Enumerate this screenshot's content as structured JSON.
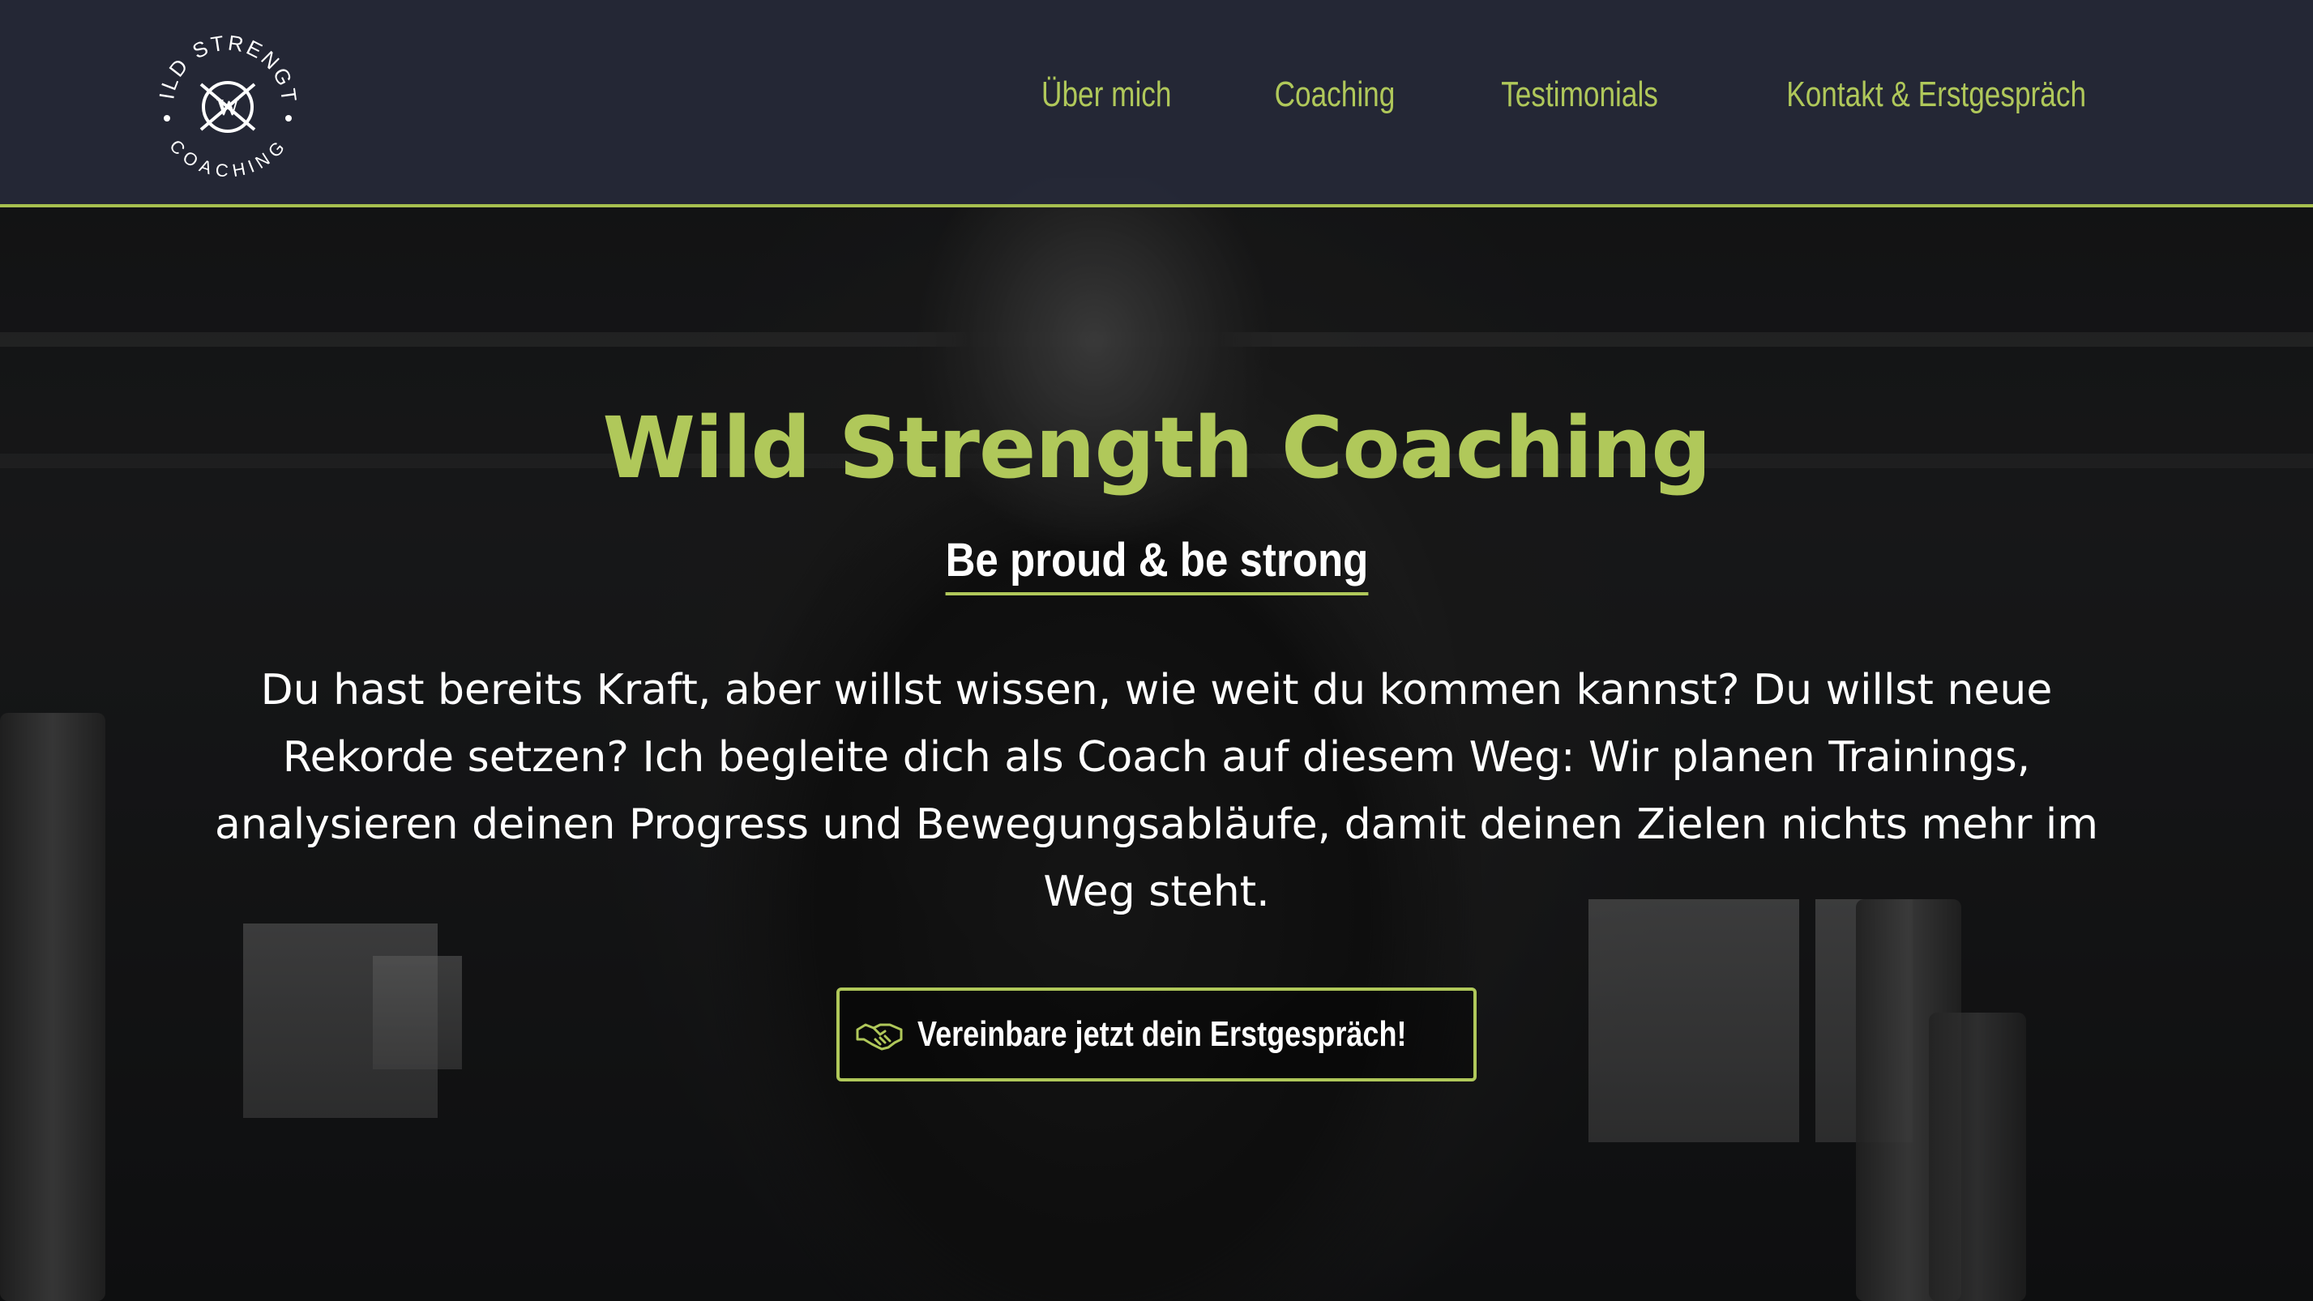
{
  "brand": {
    "logo_alt": "Wild Strength Coaching",
    "logo_text_top": "WILD STRENGTH",
    "logo_text_bottom": "COACHING",
    "logo_monogram": "W",
    "accent_color": "#b0c85a",
    "header_color": "#262938"
  },
  "nav": {
    "items": [
      {
        "label": "Über mich"
      },
      {
        "label": "Coaching"
      },
      {
        "label": "Testimonials"
      },
      {
        "label": "Kontakt & Erstgespräch"
      }
    ]
  },
  "hero": {
    "title": "Wild Strength Coaching",
    "tagline": "Be proud & be strong",
    "text": "Du hast bereits Kraft, aber willst wissen, wie weit du kommen kannst? Du willst neue Rekorde setzen? Ich begleite dich als Coach auf diesem Weg: Wir planen Trainings, analysieren deinen Progress und Bewegungsabläufe, damit deinen Zielen nichts mehr im Weg steht.",
    "cta": {
      "icon": "handshake-icon",
      "label": "Vereinbare jetzt dein Erstgespräch!"
    },
    "background": "grayscale gym photo"
  }
}
